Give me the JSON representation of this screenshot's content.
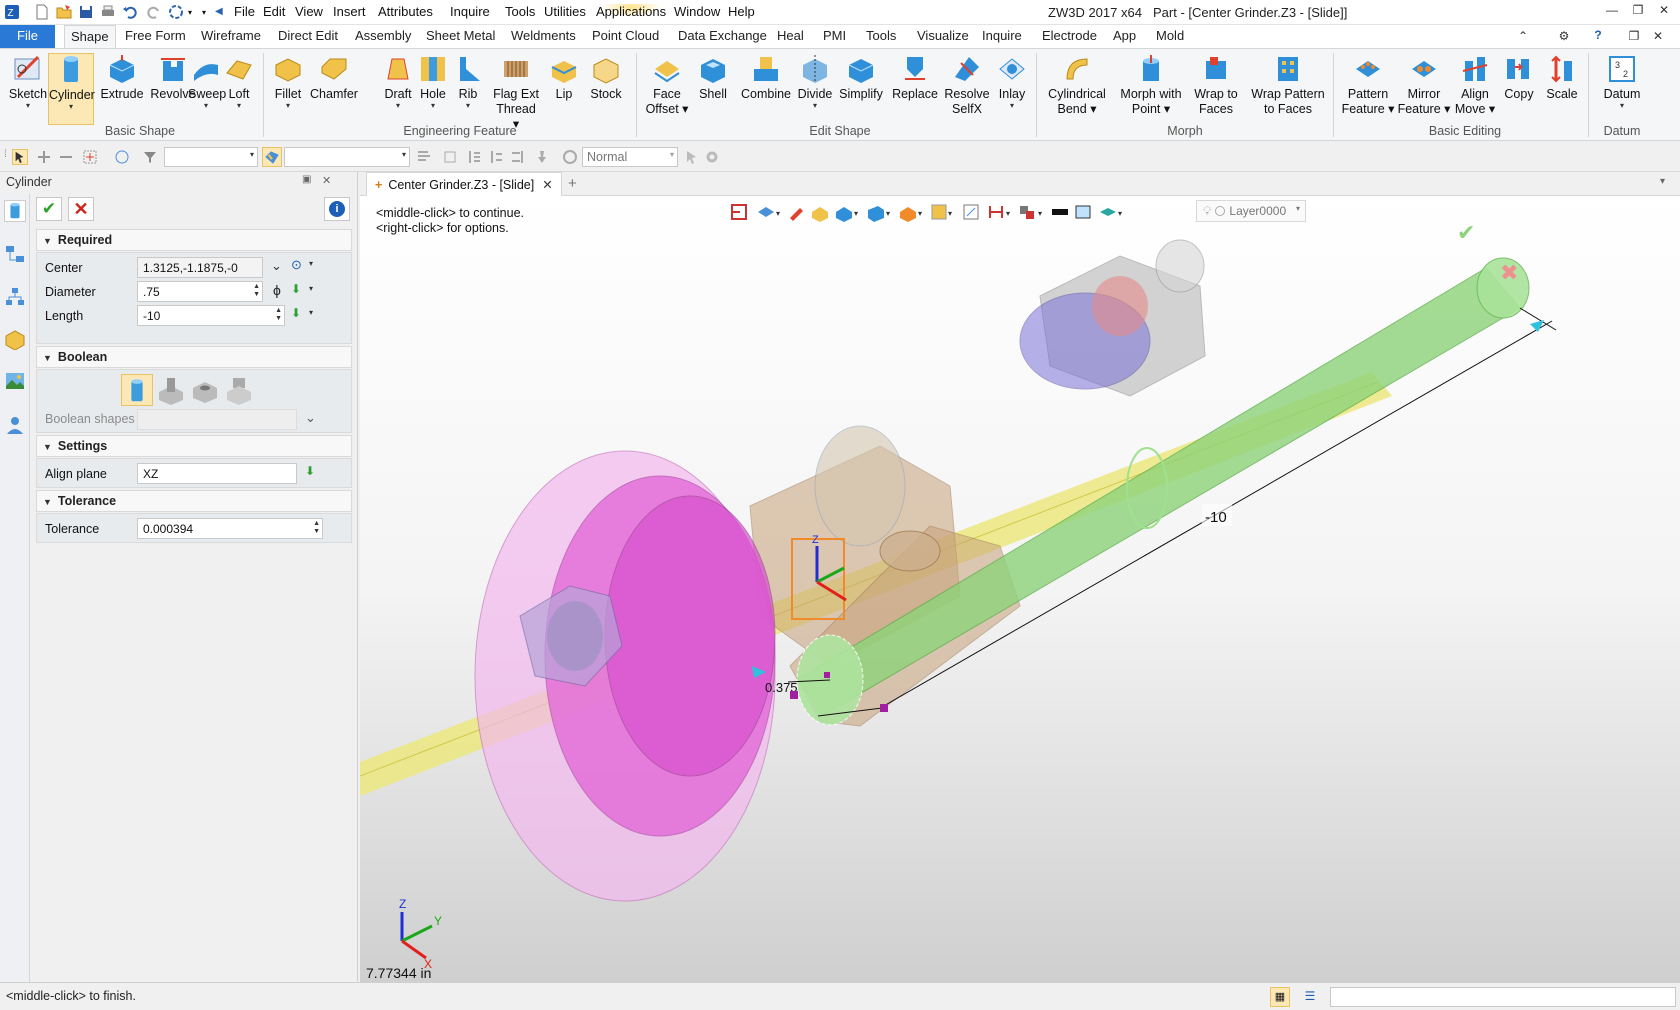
{
  "menu": {
    "items": [
      "File",
      "Edit",
      "View",
      "Insert",
      "Attributes",
      "Inquire",
      "Tools",
      "Utilities",
      "Applications",
      "Window",
      "Help"
    ]
  },
  "window": {
    "app_title": "ZW3D 2017  x64",
    "doc_title": "Part - [Center Grinder.Z3 - [Slide]]"
  },
  "ribbon_tabs": [
    "File",
    "Shape",
    "Free Form",
    "Wireframe",
    "Direct Edit",
    "Assembly",
    "Sheet Metal",
    "Weldments",
    "Point Cloud",
    "Data Exchange",
    "Heal",
    "PMI",
    "Tools",
    "Visualize",
    "Inquire",
    "Electrode",
    "App",
    "Mold"
  ],
  "ribbon": {
    "basic_shape": {
      "label": "Basic Shape",
      "buttons": [
        "Sketch",
        "Cylinder",
        "Extrude",
        "Revolve",
        "Sweep",
        "Loft"
      ]
    },
    "engineering": {
      "label": "Engineering Feature",
      "buttons": [
        "Fillet",
        "Chamfer",
        "Draft",
        "Hole",
        "Rib",
        "Flag Ext",
        "Thread",
        "Lip",
        "Stock"
      ]
    },
    "edit_shape": {
      "label": "Edit Shape",
      "buttons": [
        "Face",
        "Offset",
        "Shell",
        "Combine",
        "Divide",
        "Simplify",
        "Replace",
        "Resolve",
        "SelfX",
        "Inlay"
      ]
    },
    "morph": {
      "label": "Morph",
      "buttons": [
        "Cylindrical",
        "Bend",
        "Morph with",
        "Point",
        "Wrap to",
        "Faces",
        "Wrap Pattern",
        "to Faces"
      ]
    },
    "basic_editing": {
      "label": "Basic Editing",
      "buttons": [
        "Pattern",
        "Feature",
        "Mirror",
        "Feature",
        "Align",
        "Move",
        "Copy",
        "Scale"
      ]
    },
    "datum": {
      "label": "Datum",
      "buttons": [
        "Datum"
      ]
    }
  },
  "toolbar": {
    "render_mode": "Normal"
  },
  "panel": {
    "title": "Cylinder",
    "required": {
      "label": "Required",
      "center_label": "Center",
      "center_value": "1.3125,-1.1875,-0",
      "diameter_label": "Diameter",
      "diameter_value": ".75",
      "length_label": "Length",
      "length_value": "-10"
    },
    "boolean": {
      "label": "Boolean",
      "shapes_label": "Boolean shapes"
    },
    "settings": {
      "label": "Settings",
      "align_plane_label": "Align plane",
      "align_plane_value": "XZ"
    },
    "tolerance": {
      "label": "Tolerance",
      "tolerance_label": "Tolerance",
      "tolerance_value": "0.000394"
    }
  },
  "viewport": {
    "doc_tab": "Center Grinder.Z3 - [Slide]",
    "hint_line1": "<middle-click> to continue.",
    "hint_line2": "<right-click> for options.",
    "layer": "Layer0000",
    "dim_length": "-10",
    "dim_radius": "0.375",
    "scale_readout": "7.77344 in",
    "axis_x": "X",
    "axis_y": "Y",
    "axis_z": "Z"
  },
  "status": {
    "text": "<middle-click> to finish."
  },
  "colors": {
    "accent": "#2b79d7",
    "cylinder_preview": "#8ed37a",
    "wheel": "#e36ad8",
    "shaft": "#e8e07a",
    "housing": "#9b86d9"
  }
}
